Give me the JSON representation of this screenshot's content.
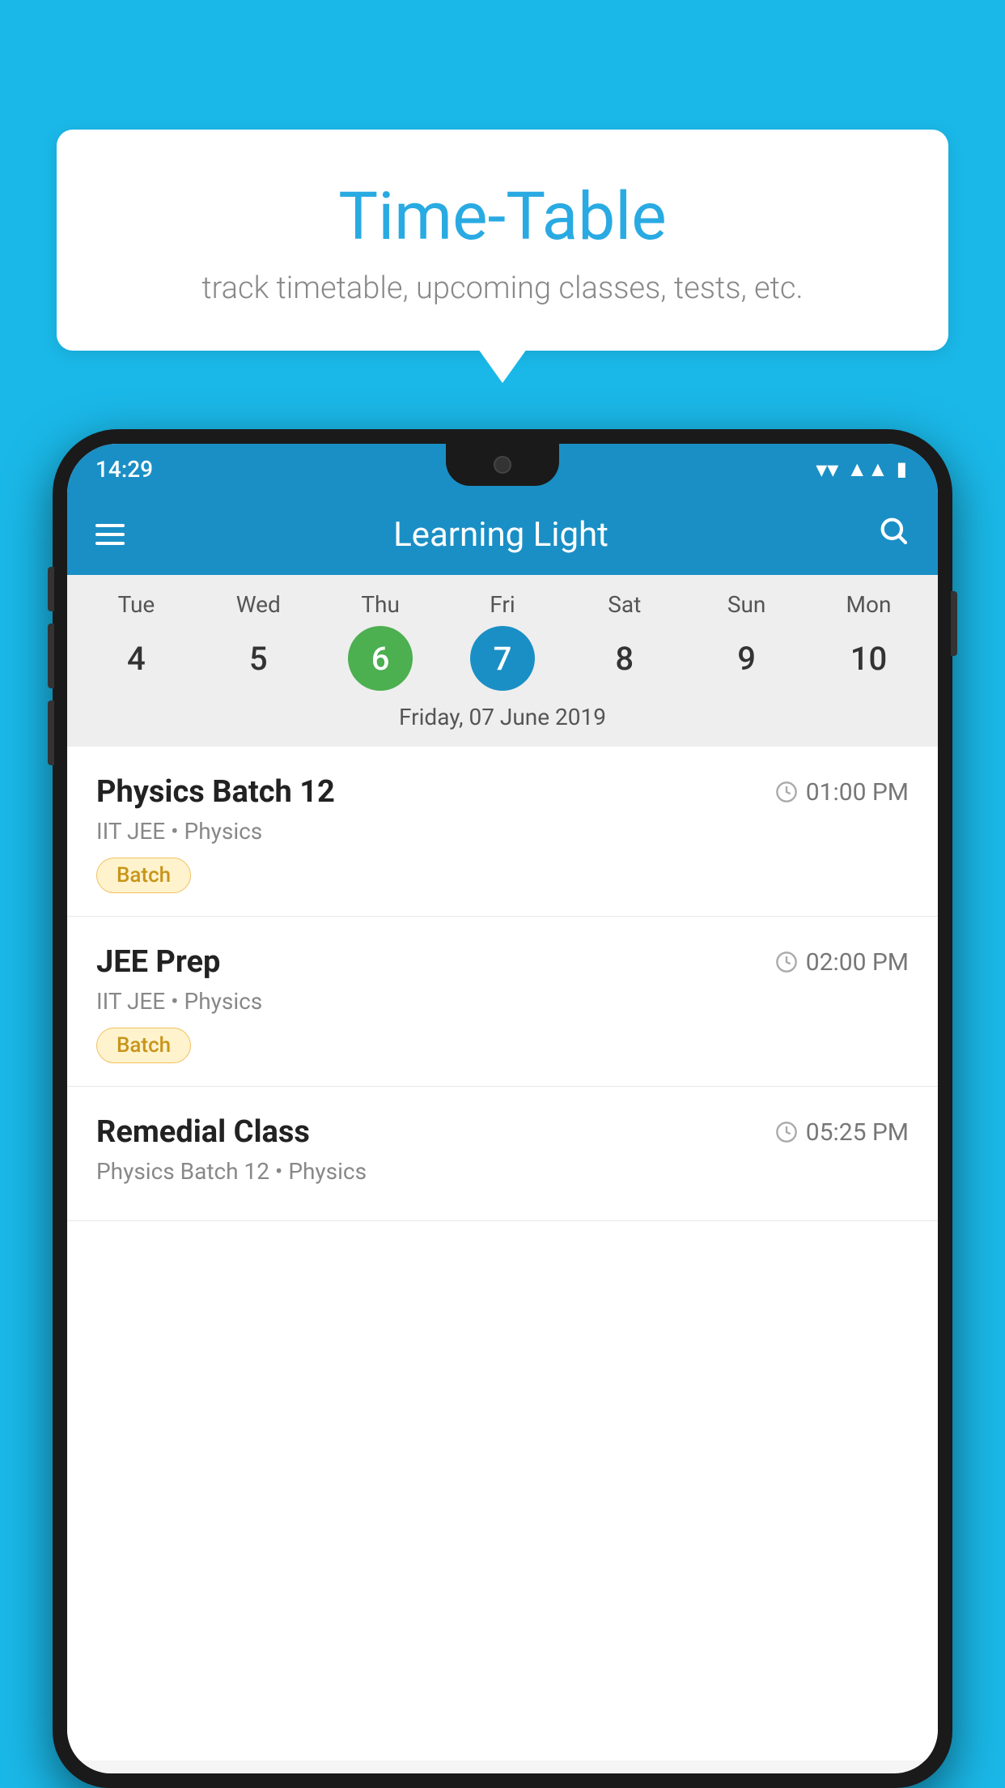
{
  "page": {
    "background_color": "#1ab8e8"
  },
  "bubble": {
    "title": "Time-Table",
    "subtitle": "track timetable, upcoming classes, tests, etc."
  },
  "app": {
    "name": "Learning Light",
    "status_time": "14:29"
  },
  "calendar": {
    "selected_date_label": "Friday, 07 June 2019",
    "days": [
      {
        "label": "Tue",
        "number": "4",
        "state": "normal"
      },
      {
        "label": "Wed",
        "number": "5",
        "state": "normal"
      },
      {
        "label": "Thu",
        "number": "6",
        "state": "today"
      },
      {
        "label": "Fri",
        "number": "7",
        "state": "selected"
      },
      {
        "label": "Sat",
        "number": "8",
        "state": "normal"
      },
      {
        "label": "Sun",
        "number": "9",
        "state": "normal"
      },
      {
        "label": "Mon",
        "number": "10",
        "state": "normal"
      }
    ]
  },
  "schedule": {
    "items": [
      {
        "title": "Physics Batch 12",
        "time": "01:00 PM",
        "meta": "IIT JEE • Physics",
        "badge": "Batch"
      },
      {
        "title": "JEE Prep",
        "time": "02:00 PM",
        "meta": "IIT JEE • Physics",
        "badge": "Batch"
      },
      {
        "title": "Remedial Class",
        "time": "05:25 PM",
        "meta": "Physics Batch 12 • Physics",
        "badge": null
      }
    ]
  },
  "icons": {
    "hamburger": "≡",
    "search": "🔍",
    "clock": "🕐"
  }
}
